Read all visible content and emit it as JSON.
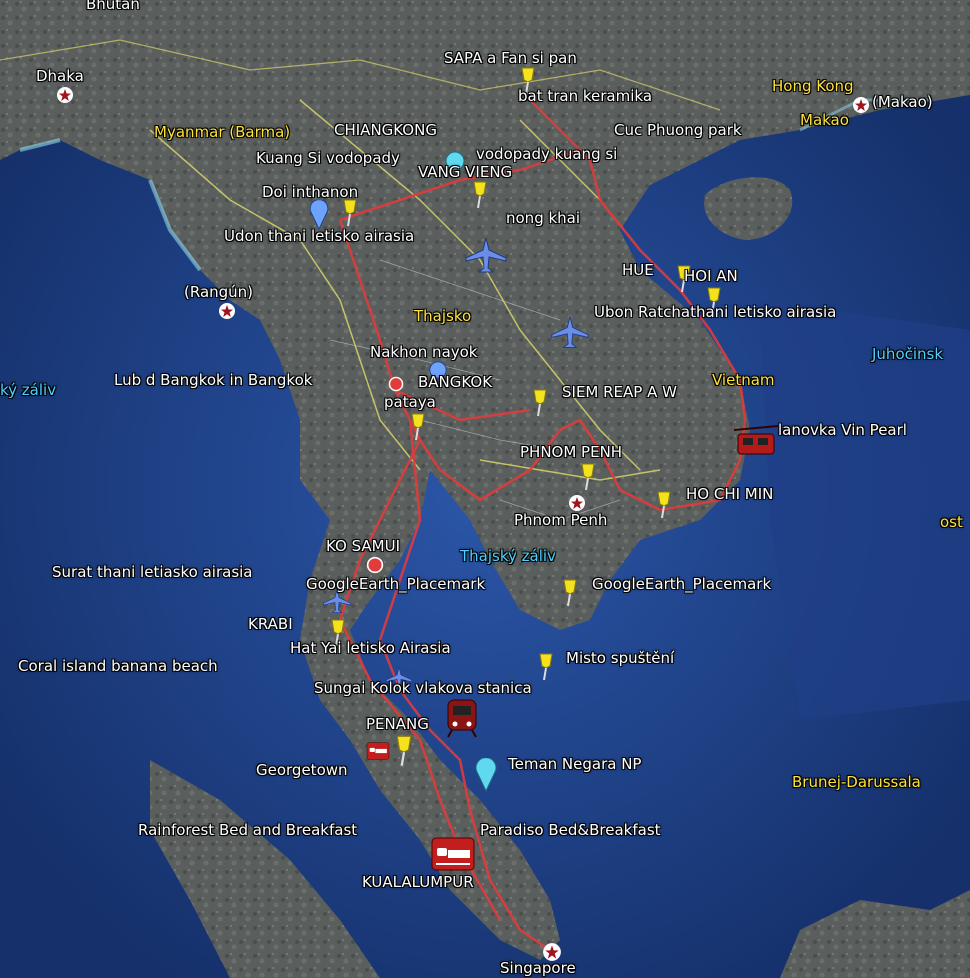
{
  "map": {
    "labels": [
      {
        "id": "bhutan",
        "text": "Bhutan",
        "cls": ""
      },
      {
        "id": "dhaka",
        "text": "Dhaka",
        "cls": ""
      },
      {
        "id": "myanmar",
        "text": "Myanmar (Barma)",
        "cls": "yel"
      },
      {
        "id": "rangun",
        "text": "(Rangún)",
        "cls": ""
      },
      {
        "id": "zaliv-left",
        "text": "ký záliv",
        "cls": "cyan"
      },
      {
        "id": "sapa",
        "text": "SAPA a Fan si pan",
        "cls": ""
      },
      {
        "id": "bat-tran",
        "text": "bat tran keramika",
        "cls": ""
      },
      {
        "id": "hong-kong",
        "text": "Hong Kong",
        "cls": "yel"
      },
      {
        "id": "makao-paren",
        "text": "(Makao)",
        "cls": ""
      },
      {
        "id": "makao",
        "text": "Makao",
        "cls": "yel"
      },
      {
        "id": "cuc-phuong",
        "text": "Cuc Phuong park",
        "cls": ""
      },
      {
        "id": "chiangkong",
        "text": "CHIANGKONG",
        "cls": ""
      },
      {
        "id": "kuang-si",
        "text": "Kuang Si vodopady",
        "cls": ""
      },
      {
        "id": "vodopady",
        "text": "vodopady kuang si",
        "cls": ""
      },
      {
        "id": "vang-vieng",
        "text": "VANG VIENG",
        "cls": ""
      },
      {
        "id": "doi-inthanon",
        "text": "Doi inthanon",
        "cls": ""
      },
      {
        "id": "nong-khai",
        "text": "nong khai",
        "cls": ""
      },
      {
        "id": "udon",
        "text": "Udon thani letisko airasia",
        "cls": ""
      },
      {
        "id": "hue",
        "text": "HUE",
        "cls": ""
      },
      {
        "id": "hoi-an",
        "text": "HOI AN",
        "cls": ""
      },
      {
        "id": "ubon",
        "text": "Ubon Ratchathani letisko airasia",
        "cls": ""
      },
      {
        "id": "thajsko",
        "text": "Thajsko",
        "cls": "yel"
      },
      {
        "id": "juhocinske",
        "text": "Juhočinsk",
        "cls": "cyan"
      },
      {
        "id": "nakhon",
        "text": "Nakhon nayok",
        "cls": ""
      },
      {
        "id": "lub-d",
        "text": "Lub d Bangkok in Bangkok",
        "cls": ""
      },
      {
        "id": "bangkok",
        "text": "BANGKOK",
        "cls": ""
      },
      {
        "id": "siem-reap",
        "text": "SIEM REAP A W",
        "cls": ""
      },
      {
        "id": "vietnam",
        "text": "Vietnam",
        "cls": "yel"
      },
      {
        "id": "pataya",
        "text": "pataya",
        "cls": ""
      },
      {
        "id": "vin-pearl",
        "text": "lanovka Vin Pearl",
        "cls": ""
      },
      {
        "id": "phnom-penh-caps",
        "text": "PHNOM PENH",
        "cls": ""
      },
      {
        "id": "ho-chi-min",
        "text": "HO CHI MIN",
        "cls": ""
      },
      {
        "id": "phnom-penh",
        "text": "Phnom Penh",
        "cls": ""
      },
      {
        "id": "ost",
        "text": "ost",
        "cls": "yel"
      },
      {
        "id": "ko-samui",
        "text": "KO SAMUI",
        "cls": ""
      },
      {
        "id": "thajsky-zaliv",
        "text": "Thajský záliv",
        "cls": "cyan"
      },
      {
        "id": "surat-thani",
        "text": "Surat thani letiasko airasia",
        "cls": ""
      },
      {
        "id": "ge-placemark-1",
        "text": "GoogleEarth_Placemark",
        "cls": ""
      },
      {
        "id": "ge-placemark-2",
        "text": "GoogleEarth_Placemark",
        "cls": ""
      },
      {
        "id": "krabi",
        "text": "KRABI",
        "cls": ""
      },
      {
        "id": "hat-yai",
        "text": "Hat Yai letisko Airasia",
        "cls": ""
      },
      {
        "id": "coral-island",
        "text": "Coral island banana beach",
        "cls": ""
      },
      {
        "id": "misto",
        "text": "Misto spuštění",
        "cls": ""
      },
      {
        "id": "sungai-kolok",
        "text": "Sungai Kolok vlakova stanica",
        "cls": ""
      },
      {
        "id": "penang",
        "text": "PENANG",
        "cls": ""
      },
      {
        "id": "georgetown",
        "text": "Georgetown",
        "cls": ""
      },
      {
        "id": "teman-negara",
        "text": "Teman Negara NP",
        "cls": ""
      },
      {
        "id": "brunej",
        "text": "Brunej-Darussala",
        "cls": "yel"
      },
      {
        "id": "rainforest",
        "text": "Rainforest Bed and Breakfast",
        "cls": ""
      },
      {
        "id": "paradiso",
        "text": "Paradiso Bed&Breakfast",
        "cls": ""
      },
      {
        "id": "kualalumpur",
        "text": "KUALALUMPUR",
        "cls": ""
      },
      {
        "id": "singapore",
        "text": "Singapore",
        "cls": ""
      }
    ],
    "markers": [
      {
        "id": "pin-sapa",
        "icon": "yellow-pushpin-icon"
      },
      {
        "id": "pin-doi-inthanon",
        "icon": "yellow-pushpin-icon"
      },
      {
        "id": "pin-vang-vieng",
        "icon": "yellow-pushpin-icon"
      },
      {
        "id": "pin-hoi-an-1",
        "icon": "yellow-pushpin-icon"
      },
      {
        "id": "pin-hoi-an-2",
        "icon": "yellow-pushpin-icon"
      },
      {
        "id": "pin-pataya",
        "icon": "yellow-pushpin-icon"
      },
      {
        "id": "pin-siem-reap",
        "icon": "yellow-pushpin-icon"
      },
      {
        "id": "pin-phnom-penh",
        "icon": "yellow-pushpin-icon"
      },
      {
        "id": "pin-ho-chi-min",
        "icon": "yellow-pushpin-icon"
      },
      {
        "id": "pin-placemark",
        "icon": "yellow-pushpin-icon"
      },
      {
        "id": "pin-krabi",
        "icon": "yellow-pushpin-icon"
      },
      {
        "id": "pin-misto",
        "icon": "yellow-pushpin-icon"
      },
      {
        "id": "pin-penang",
        "icon": "yellow-pushpin-icon"
      },
      {
        "id": "plane-udon",
        "icon": "airplane-icon"
      },
      {
        "id": "plane-ubon",
        "icon": "airplane-icon"
      },
      {
        "id": "plane-surat",
        "icon": "airplane-icon"
      },
      {
        "id": "plane-hat-yai",
        "icon": "airplane-icon"
      },
      {
        "id": "train-kolok",
        "icon": "train-icon"
      },
      {
        "id": "lift-vin-pearl",
        "icon": "cable-car-icon"
      },
      {
        "id": "bed-kl",
        "icon": "bed-icon"
      },
      {
        "id": "bed-georgetown",
        "icon": "bed-icon"
      },
      {
        "id": "star-dhaka",
        "icon": "capital-star-icon"
      },
      {
        "id": "star-rangun",
        "icon": "capital-star-icon"
      },
      {
        "id": "star-makao",
        "icon": "capital-star-icon"
      },
      {
        "id": "star-phnom-penh",
        "icon": "capital-star-icon"
      },
      {
        "id": "star-singapore",
        "icon": "capital-star-icon"
      },
      {
        "id": "bubble-teman",
        "icon": "cyan-placemark-icon"
      },
      {
        "id": "bubble-doi",
        "icon": "blue-placemark-icon"
      }
    ],
    "colors": {
      "sea": "#1b3f86",
      "land": "#5a5f5e",
      "route": "#e13b3b",
      "border": "#d9d36a",
      "pin": "#f4e21c"
    }
  }
}
